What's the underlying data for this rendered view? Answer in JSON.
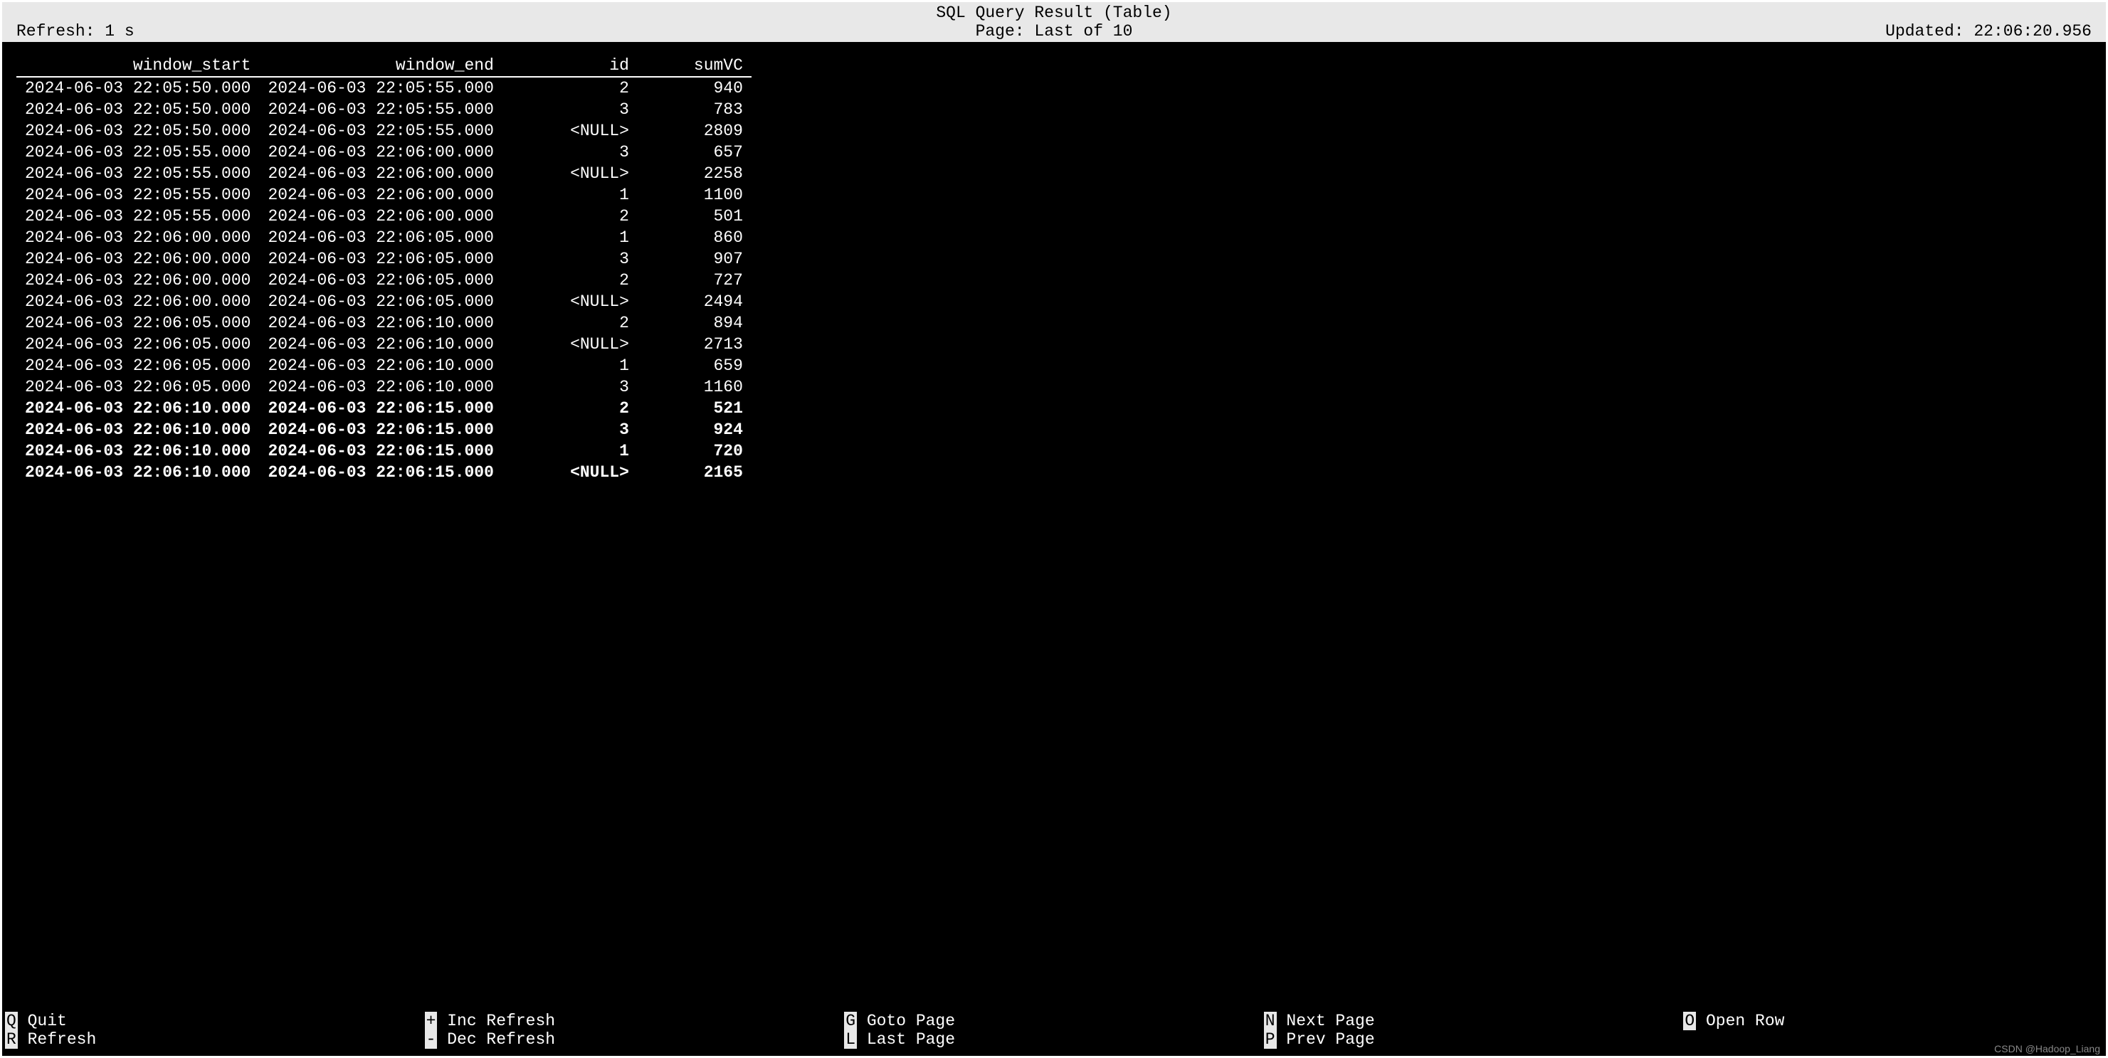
{
  "header": {
    "title": "SQL Query Result (Table)",
    "refresh": "Refresh: 1 s",
    "page": "Page: Last of 10",
    "updated": "Updated: 22:06:20.956"
  },
  "columns": {
    "window_start": "window_start",
    "window_end": "window_end",
    "id": "id",
    "sumVC": "sumVC"
  },
  "rows": [
    {
      "ws": "2024-06-03 22:05:50.000",
      "we": "2024-06-03 22:05:55.000",
      "id": "2",
      "sum": "940",
      "bold": false
    },
    {
      "ws": "2024-06-03 22:05:50.000",
      "we": "2024-06-03 22:05:55.000",
      "id": "3",
      "sum": "783",
      "bold": false
    },
    {
      "ws": "2024-06-03 22:05:50.000",
      "we": "2024-06-03 22:05:55.000",
      "id": "<NULL>",
      "sum": "2809",
      "bold": false
    },
    {
      "ws": "2024-06-03 22:05:55.000",
      "we": "2024-06-03 22:06:00.000",
      "id": "3",
      "sum": "657",
      "bold": false
    },
    {
      "ws": "2024-06-03 22:05:55.000",
      "we": "2024-06-03 22:06:00.000",
      "id": "<NULL>",
      "sum": "2258",
      "bold": false
    },
    {
      "ws": "2024-06-03 22:05:55.000",
      "we": "2024-06-03 22:06:00.000",
      "id": "1",
      "sum": "1100",
      "bold": false
    },
    {
      "ws": "2024-06-03 22:05:55.000",
      "we": "2024-06-03 22:06:00.000",
      "id": "2",
      "sum": "501",
      "bold": false
    },
    {
      "ws": "2024-06-03 22:06:00.000",
      "we": "2024-06-03 22:06:05.000",
      "id": "1",
      "sum": "860",
      "bold": false
    },
    {
      "ws": "2024-06-03 22:06:00.000",
      "we": "2024-06-03 22:06:05.000",
      "id": "3",
      "sum": "907",
      "bold": false
    },
    {
      "ws": "2024-06-03 22:06:00.000",
      "we": "2024-06-03 22:06:05.000",
      "id": "2",
      "sum": "727",
      "bold": false
    },
    {
      "ws": "2024-06-03 22:06:00.000",
      "we": "2024-06-03 22:06:05.000",
      "id": "<NULL>",
      "sum": "2494",
      "bold": false
    },
    {
      "ws": "2024-06-03 22:06:05.000",
      "we": "2024-06-03 22:06:10.000",
      "id": "2",
      "sum": "894",
      "bold": false
    },
    {
      "ws": "2024-06-03 22:06:05.000",
      "we": "2024-06-03 22:06:10.000",
      "id": "<NULL>",
      "sum": "2713",
      "bold": false
    },
    {
      "ws": "2024-06-03 22:06:05.000",
      "we": "2024-06-03 22:06:10.000",
      "id": "1",
      "sum": "659",
      "bold": false
    },
    {
      "ws": "2024-06-03 22:06:05.000",
      "we": "2024-06-03 22:06:10.000",
      "id": "3",
      "sum": "1160",
      "bold": false
    },
    {
      "ws": "2024-06-03 22:06:10.000",
      "we": "2024-06-03 22:06:15.000",
      "id": "2",
      "sum": "521",
      "bold": true
    },
    {
      "ws": "2024-06-03 22:06:10.000",
      "we": "2024-06-03 22:06:15.000",
      "id": "3",
      "sum": "924",
      "bold": true
    },
    {
      "ws": "2024-06-03 22:06:10.000",
      "we": "2024-06-03 22:06:15.000",
      "id": "1",
      "sum": "720",
      "bold": true
    },
    {
      "ws": "2024-06-03 22:06:10.000",
      "we": "2024-06-03 22:06:15.000",
      "id": "<NULL>",
      "sum": "2165",
      "bold": true
    }
  ],
  "footer": {
    "quit": {
      "key": "Q",
      "label": "Quit"
    },
    "refresh": {
      "key": "R",
      "label": "Refresh"
    },
    "inc": {
      "key": "+",
      "label": "Inc Refresh"
    },
    "dec": {
      "key": "-",
      "label": "Dec Refresh"
    },
    "goto": {
      "key": "G",
      "label": "Goto Page"
    },
    "last": {
      "key": "L",
      "label": "Last Page"
    },
    "next": {
      "key": "N",
      "label": "Next Page"
    },
    "prev": {
      "key": "P",
      "label": "Prev Page"
    },
    "open": {
      "key": "O",
      "label": "Open Row"
    }
  },
  "watermark": "CSDN @Hadoop_Liang"
}
